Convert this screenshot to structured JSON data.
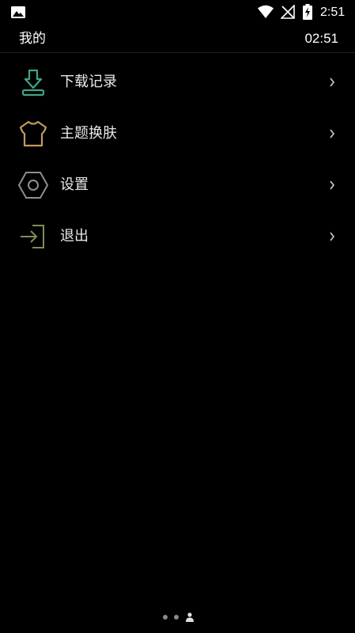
{
  "status_bar": {
    "time": "2:51",
    "icons": [
      "image-icon",
      "wifi-icon",
      "no-signal-icon",
      "battery-charging-icon"
    ]
  },
  "header": {
    "title": "我的",
    "time": "02:51"
  },
  "menu": [
    {
      "label": "下载记录",
      "icon": "download-icon",
      "color": "#3fa58a"
    },
    {
      "label": "主题换肤",
      "icon": "shirt-icon",
      "color": "#c29a5f"
    },
    {
      "label": "设置",
      "icon": "settings-hex-icon",
      "color": "#8f8f8f"
    },
    {
      "label": "退出",
      "icon": "logout-icon",
      "color": "#7f8e58"
    }
  ],
  "pager": {
    "pages": 3,
    "active_index": 2,
    "active_icon": "person-icon"
  }
}
